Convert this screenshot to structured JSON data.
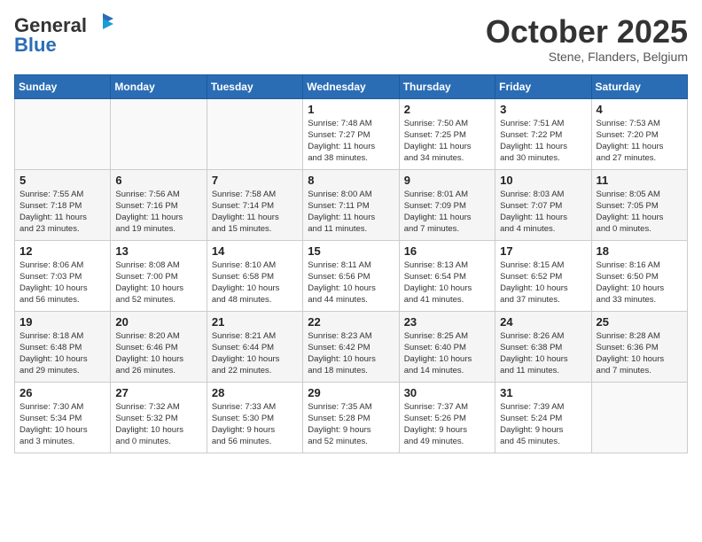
{
  "header": {
    "logo_line1": "General",
    "logo_line2": "Blue",
    "month": "October 2025",
    "location": "Stene, Flanders, Belgium"
  },
  "weekdays": [
    "Sunday",
    "Monday",
    "Tuesday",
    "Wednesday",
    "Thursday",
    "Friday",
    "Saturday"
  ],
  "weeks": [
    [
      {
        "day": "",
        "info": ""
      },
      {
        "day": "",
        "info": ""
      },
      {
        "day": "",
        "info": ""
      },
      {
        "day": "1",
        "info": "Sunrise: 7:48 AM\nSunset: 7:27 PM\nDaylight: 11 hours\nand 38 minutes."
      },
      {
        "day": "2",
        "info": "Sunrise: 7:50 AM\nSunset: 7:25 PM\nDaylight: 11 hours\nand 34 minutes."
      },
      {
        "day": "3",
        "info": "Sunrise: 7:51 AM\nSunset: 7:22 PM\nDaylight: 11 hours\nand 30 minutes."
      },
      {
        "day": "4",
        "info": "Sunrise: 7:53 AM\nSunset: 7:20 PM\nDaylight: 11 hours\nand 27 minutes."
      }
    ],
    [
      {
        "day": "5",
        "info": "Sunrise: 7:55 AM\nSunset: 7:18 PM\nDaylight: 11 hours\nand 23 minutes."
      },
      {
        "day": "6",
        "info": "Sunrise: 7:56 AM\nSunset: 7:16 PM\nDaylight: 11 hours\nand 19 minutes."
      },
      {
        "day": "7",
        "info": "Sunrise: 7:58 AM\nSunset: 7:14 PM\nDaylight: 11 hours\nand 15 minutes."
      },
      {
        "day": "8",
        "info": "Sunrise: 8:00 AM\nSunset: 7:11 PM\nDaylight: 11 hours\nand 11 minutes."
      },
      {
        "day": "9",
        "info": "Sunrise: 8:01 AM\nSunset: 7:09 PM\nDaylight: 11 hours\nand 7 minutes."
      },
      {
        "day": "10",
        "info": "Sunrise: 8:03 AM\nSunset: 7:07 PM\nDaylight: 11 hours\nand 4 minutes."
      },
      {
        "day": "11",
        "info": "Sunrise: 8:05 AM\nSunset: 7:05 PM\nDaylight: 11 hours\nand 0 minutes."
      }
    ],
    [
      {
        "day": "12",
        "info": "Sunrise: 8:06 AM\nSunset: 7:03 PM\nDaylight: 10 hours\nand 56 minutes."
      },
      {
        "day": "13",
        "info": "Sunrise: 8:08 AM\nSunset: 7:00 PM\nDaylight: 10 hours\nand 52 minutes."
      },
      {
        "day": "14",
        "info": "Sunrise: 8:10 AM\nSunset: 6:58 PM\nDaylight: 10 hours\nand 48 minutes."
      },
      {
        "day": "15",
        "info": "Sunrise: 8:11 AM\nSunset: 6:56 PM\nDaylight: 10 hours\nand 44 minutes."
      },
      {
        "day": "16",
        "info": "Sunrise: 8:13 AM\nSunset: 6:54 PM\nDaylight: 10 hours\nand 41 minutes."
      },
      {
        "day": "17",
        "info": "Sunrise: 8:15 AM\nSunset: 6:52 PM\nDaylight: 10 hours\nand 37 minutes."
      },
      {
        "day": "18",
        "info": "Sunrise: 8:16 AM\nSunset: 6:50 PM\nDaylight: 10 hours\nand 33 minutes."
      }
    ],
    [
      {
        "day": "19",
        "info": "Sunrise: 8:18 AM\nSunset: 6:48 PM\nDaylight: 10 hours\nand 29 minutes."
      },
      {
        "day": "20",
        "info": "Sunrise: 8:20 AM\nSunset: 6:46 PM\nDaylight: 10 hours\nand 26 minutes."
      },
      {
        "day": "21",
        "info": "Sunrise: 8:21 AM\nSunset: 6:44 PM\nDaylight: 10 hours\nand 22 minutes."
      },
      {
        "day": "22",
        "info": "Sunrise: 8:23 AM\nSunset: 6:42 PM\nDaylight: 10 hours\nand 18 minutes."
      },
      {
        "day": "23",
        "info": "Sunrise: 8:25 AM\nSunset: 6:40 PM\nDaylight: 10 hours\nand 14 minutes."
      },
      {
        "day": "24",
        "info": "Sunrise: 8:26 AM\nSunset: 6:38 PM\nDaylight: 10 hours\nand 11 minutes."
      },
      {
        "day": "25",
        "info": "Sunrise: 8:28 AM\nSunset: 6:36 PM\nDaylight: 10 hours\nand 7 minutes."
      }
    ],
    [
      {
        "day": "26",
        "info": "Sunrise: 7:30 AM\nSunset: 5:34 PM\nDaylight: 10 hours\nand 3 minutes."
      },
      {
        "day": "27",
        "info": "Sunrise: 7:32 AM\nSunset: 5:32 PM\nDaylight: 10 hours\nand 0 minutes."
      },
      {
        "day": "28",
        "info": "Sunrise: 7:33 AM\nSunset: 5:30 PM\nDaylight: 9 hours\nand 56 minutes."
      },
      {
        "day": "29",
        "info": "Sunrise: 7:35 AM\nSunset: 5:28 PM\nDaylight: 9 hours\nand 52 minutes."
      },
      {
        "day": "30",
        "info": "Sunrise: 7:37 AM\nSunset: 5:26 PM\nDaylight: 9 hours\nand 49 minutes."
      },
      {
        "day": "31",
        "info": "Sunrise: 7:39 AM\nSunset: 5:24 PM\nDaylight: 9 hours\nand 45 minutes."
      },
      {
        "day": "",
        "info": ""
      }
    ]
  ]
}
